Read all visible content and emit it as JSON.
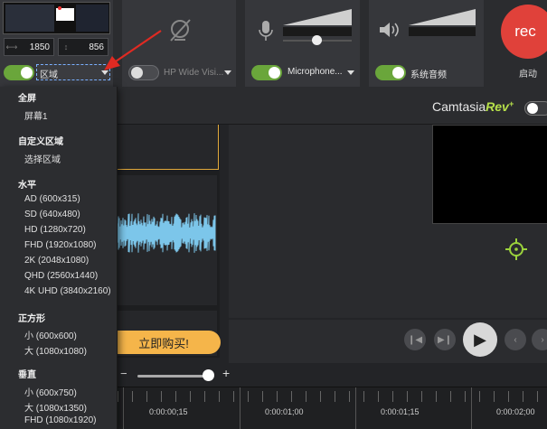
{
  "recorder": {
    "width_value": "1850",
    "height_value": "856",
    "screen_select_label": "区域",
    "camera_label": "HP Wide Visi...",
    "mic_label": "Microphone...",
    "system_audio_label": "系统音频",
    "rec_label": "rec",
    "start_label": "启动"
  },
  "brand": {
    "name": "Camtasia",
    "suffix": "Rev",
    "plus": "+"
  },
  "buy_label": "立即购买!",
  "zoom": {
    "minus": "−",
    "plus": "+"
  },
  "timecodes": [
    "0:00:00;15",
    "0:00:01;00",
    "0:00:01;15",
    "0:00:02;00"
  ],
  "menu": {
    "full_screen_header": "全屏",
    "screen1": "屏幕1",
    "custom_header": "自定义区域",
    "select_area": "选择区域",
    "horizontal_header": "水平",
    "horizontal_items": [
      "AD (600x315)",
      "SD (640x480)",
      "HD (1280x720)",
      "FHD (1920x1080)",
      "2K (2048x1080)",
      "QHD (2560x1440)",
      "4K UHD (3840x2160)"
    ],
    "square_header": "正方形",
    "square_items": [
      "小 (600x600)",
      "大 (1080x1080)"
    ],
    "vertical_header": "垂直",
    "vertical_items": [
      "小 (600x750)",
      "大 (1080x1350)",
      "FHD (1080x1920)"
    ]
  },
  "colors": {
    "accent_green": "#6aa63b",
    "rec_red": "#e0413a",
    "buy_orange": "#f5b54a",
    "annotation_red": "#e02a22",
    "rev_green": "#b6e04a"
  }
}
